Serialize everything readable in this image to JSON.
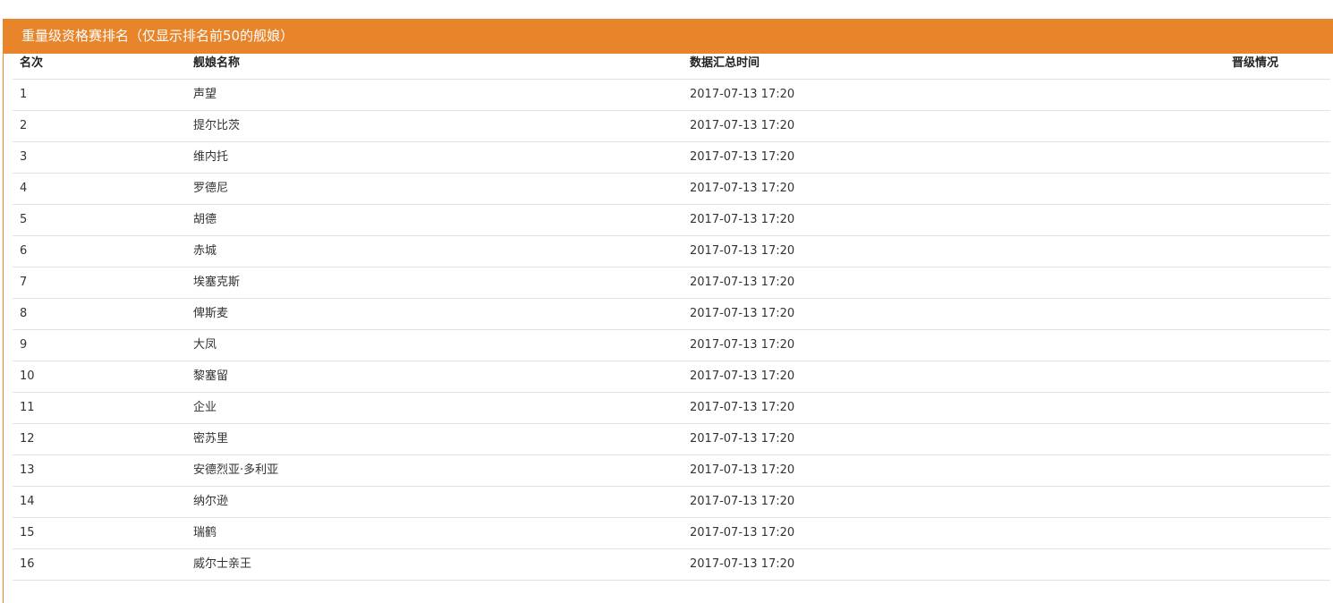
{
  "panel": {
    "title": "重量级资格赛排名（仅显示排名前50的舰娘）",
    "accent_color": "#e8842a"
  },
  "table": {
    "columns": [
      "名次",
      "舰娘名称",
      "数据汇总时间",
      "晋级情况"
    ],
    "rows": [
      {
        "rank": "1",
        "name": "声望",
        "time": "2017-07-13 17:20",
        "status": ""
      },
      {
        "rank": "2",
        "name": "提尔比茨",
        "time": "2017-07-13 17:20",
        "status": ""
      },
      {
        "rank": "3",
        "name": "维内托",
        "time": "2017-07-13 17:20",
        "status": ""
      },
      {
        "rank": "4",
        "name": "罗德尼",
        "time": "2017-07-13 17:20",
        "status": ""
      },
      {
        "rank": "5",
        "name": "胡德",
        "time": "2017-07-13 17:20",
        "status": ""
      },
      {
        "rank": "6",
        "name": "赤城",
        "time": "2017-07-13 17:20",
        "status": ""
      },
      {
        "rank": "7",
        "name": "埃塞克斯",
        "time": "2017-07-13 17:20",
        "status": ""
      },
      {
        "rank": "8",
        "name": "俾斯麦",
        "time": "2017-07-13 17:20",
        "status": ""
      },
      {
        "rank": "9",
        "name": "大凤",
        "time": "2017-07-13 17:20",
        "status": ""
      },
      {
        "rank": "10",
        "name": "黎塞留",
        "time": "2017-07-13 17:20",
        "status": ""
      },
      {
        "rank": "11",
        "name": "企业",
        "time": "2017-07-13 17:20",
        "status": ""
      },
      {
        "rank": "12",
        "name": "密苏里",
        "time": "2017-07-13 17:20",
        "status": ""
      },
      {
        "rank": "13",
        "name": "安德烈亚·多利亚",
        "time": "2017-07-13 17:20",
        "status": ""
      },
      {
        "rank": "14",
        "name": "纳尔逊",
        "time": "2017-07-13 17:20",
        "status": ""
      },
      {
        "rank": "15",
        "name": "瑞鹤",
        "time": "2017-07-13 17:20",
        "status": ""
      },
      {
        "rank": "16",
        "name": "威尔士亲王",
        "time": "2017-07-13 17:20",
        "status": ""
      }
    ]
  }
}
